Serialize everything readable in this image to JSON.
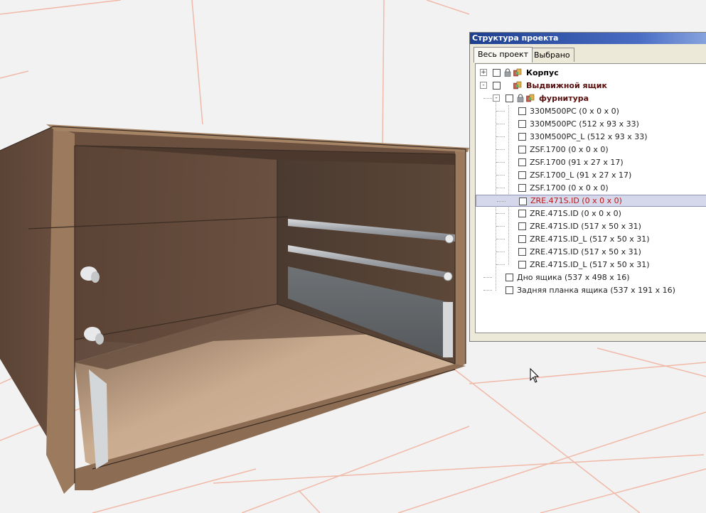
{
  "panel": {
    "title": "Структура проекта",
    "tabs": [
      {
        "label": "Весь проект",
        "active": true
      },
      {
        "label": "Выбрано",
        "active": false
      }
    ]
  },
  "tree": [
    {
      "label": "Корпус",
      "level": 0,
      "style": "bold",
      "expander": "+",
      "locked": true,
      "checked": false
    },
    {
      "label": "Выдвижной ящик",
      "level": 0,
      "style": "dark-red",
      "expander": "-",
      "locked": false,
      "checked": false
    },
    {
      "label": "фурнитура",
      "level": 1,
      "style": "dark-red",
      "expander": "-",
      "locked": true,
      "checked": false
    },
    {
      "label": "330M500PC   (0 x 0 x 0)",
      "level": 2,
      "style": "normal",
      "checked": false
    },
    {
      "label": "330M500PC   (512 x 93 x 33)",
      "level": 2,
      "style": "normal",
      "checked": false
    },
    {
      "label": "330M500PC_L   (512 x 93 x 33)",
      "level": 2,
      "style": "normal",
      "checked": false
    },
    {
      "label": "ZSF.1700   (0 x 0 x 0)",
      "level": 2,
      "style": "normal",
      "checked": false
    },
    {
      "label": "ZSF.1700   (91 x 27 x 17)",
      "level": 2,
      "style": "normal",
      "checked": false
    },
    {
      "label": "ZSF.1700_L   (91 x 27 x 17)",
      "level": 2,
      "style": "normal",
      "checked": false
    },
    {
      "label": "ZSF.1700   (0 x 0 x 0)",
      "level": 2,
      "style": "normal",
      "checked": false
    },
    {
      "label": "ZRE.471S.ID   (0 x 0 x 0)",
      "level": 2,
      "style": "red",
      "selected": true,
      "checked": false
    },
    {
      "label": "ZRE.471S.ID   (0 x 0 x 0)",
      "level": 2,
      "style": "normal",
      "checked": false
    },
    {
      "label": "ZRE.471S.ID   (517 x 50 x 31)",
      "level": 2,
      "style": "normal",
      "checked": false
    },
    {
      "label": "ZRE.471S.ID_L   (517 x 50 x 31)",
      "level": 2,
      "style": "normal",
      "checked": false
    },
    {
      "label": "ZRE.471S.ID   (517 x 50 x 31)",
      "level": 2,
      "style": "normal",
      "checked": false
    },
    {
      "label": "ZRE.471S.ID_L   (517 x 50 x 31)",
      "level": 2,
      "style": "normal",
      "checked": false
    },
    {
      "label": "Дно ящика   (537 x 498 x 16)",
      "level": 1,
      "style": "normal",
      "checked": false
    },
    {
      "label": "Задняя планка ящика   (537 x 191 x 16)",
      "level": 1,
      "style": "normal",
      "checked": false
    }
  ],
  "colors": {
    "selection": "#d4d8ea",
    "selected_text": "#c01515",
    "group_text": "#5a0f0f",
    "wood_dark": "#5e4638",
    "wood_edge": "#9b7a5e",
    "floor_light": "#c7a98c",
    "grid_line": "#f0b9a8"
  }
}
